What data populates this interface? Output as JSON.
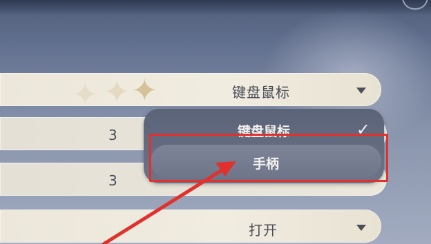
{
  "settings": {
    "device_row": {
      "value": "键盘鼠标"
    },
    "row_2": {
      "value": "3"
    },
    "row_3": {
      "value": "3"
    },
    "toggle_row": {
      "value": "打开"
    }
  },
  "dropdown": {
    "options": [
      {
        "label": "键盘鼠标",
        "selected": true
      },
      {
        "label": "手柄",
        "selected": false
      }
    ],
    "check_glyph": "✓"
  },
  "annotation": {
    "highlight_color": "#e0312e",
    "arrow_color": "#e0312e"
  }
}
